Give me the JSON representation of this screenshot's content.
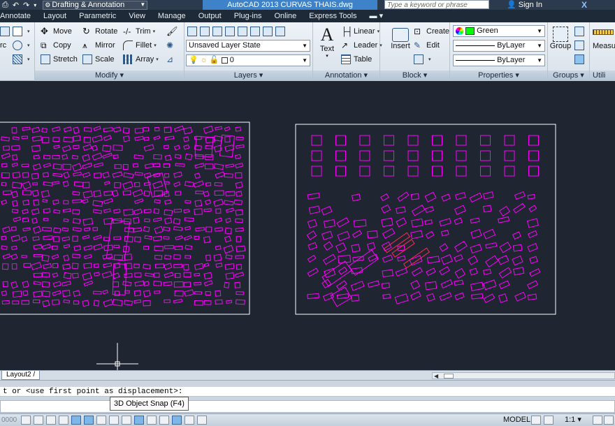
{
  "titlebar": {
    "workspace": "Drafting & Annotation",
    "title": "AutoCAD 2013    CURVAS THAIS.dwg",
    "search_placeholder": "Type a keyword or phrase",
    "sign_in": "Sign In"
  },
  "menu": [
    "Annotate",
    "Layout",
    "Parametric",
    "View",
    "Manage",
    "Output",
    "Plug-ins",
    "Online",
    "Express Tools"
  ],
  "ribbon": {
    "modify": {
      "title": "Modify ▾",
      "move": "Move",
      "rotate": "Rotate",
      "trim": "Trim",
      "copy": "Copy",
      "mirror": "Mirror",
      "fillet": "Fillet",
      "stretch": "Stretch",
      "scale": "Scale",
      "array": "Array"
    },
    "layers": {
      "title": "Layers ▾",
      "layer_state": "Unsaved Layer State",
      "current_layer": "0"
    },
    "annotation": {
      "title": "Annotation ▾",
      "text": "Text",
      "linear": "Linear",
      "leader": "Leader",
      "table": "Table"
    },
    "block": {
      "title": "Block ▾",
      "insert": "Insert",
      "create": "Create",
      "edit": "Edit"
    },
    "properties": {
      "title": "Properties ▾",
      "color": "Green",
      "linetype": "ByLayer",
      "lineweight": "ByLayer",
      "color_hex": "#00ff00"
    },
    "groups": {
      "title": "Groups ▾",
      "group": "Group"
    },
    "utilities": {
      "title": "Utili",
      "measure": "Measu"
    }
  },
  "drawing": {
    "background": "#1f2631",
    "linework_color": "#ff00ff",
    "highlight_color": "#ff2a55",
    "frame_color": "#ffffff"
  },
  "layout_tabs": {
    "active": "Layout2 /"
  },
  "command": {
    "history": "t or <use first point as displacement>:",
    "tooltip": "3D Object Snap (F4)"
  },
  "statusbar": {
    "coords": "0000",
    "model": "MODEL",
    "scale": "1:1 ▾"
  }
}
